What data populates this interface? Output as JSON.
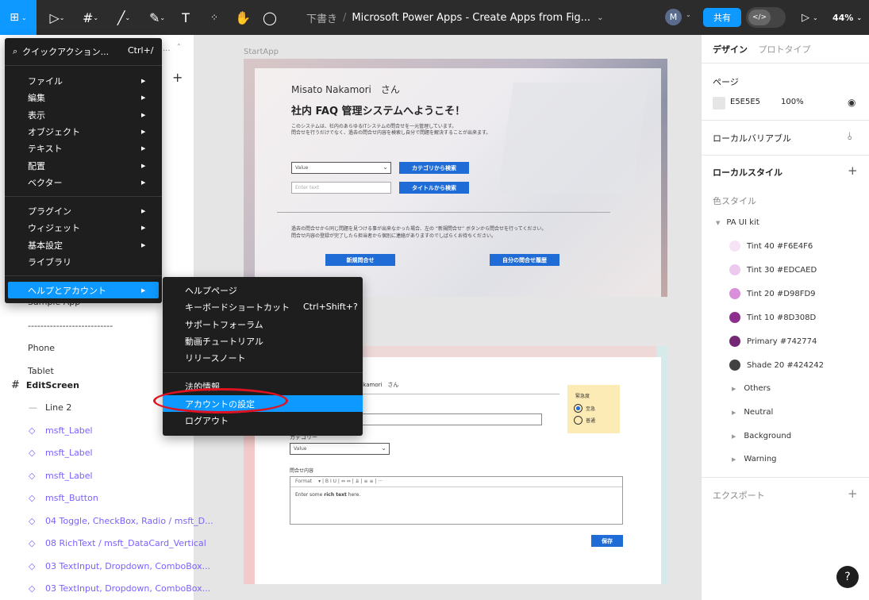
{
  "toolbar": {
    "draft_label": "下書き",
    "separator": "/",
    "file_title": "Microsoft Power Apps - Create Apps from Fig...",
    "avatar_letter": "M",
    "share_label": "共有",
    "dev_mode_label": "</>",
    "zoom": "44%"
  },
  "main_menu": {
    "quick_action": {
      "label": "クイックアクション...",
      "shortcut": "Ctrl+/"
    },
    "items_group1": [
      {
        "label": "ファイル"
      },
      {
        "label": "編集"
      },
      {
        "label": "表示"
      },
      {
        "label": "オブジェクト"
      },
      {
        "label": "テキスト"
      },
      {
        "label": "配置"
      },
      {
        "label": "ベクター"
      }
    ],
    "items_group2": [
      {
        "label": "プラグイン"
      },
      {
        "label": "ウィジェット"
      },
      {
        "label": "基本設定"
      },
      {
        "label": "ライブラリ"
      }
    ],
    "help_account": {
      "label": "ヘルプとアカウント"
    }
  },
  "help_submenu": {
    "items_group1": [
      {
        "label": "ヘルプページ",
        "shortcut": ""
      },
      {
        "label": "キーボードショートカット",
        "shortcut": "Ctrl+Shift+?"
      },
      {
        "label": "サポートフォーラム",
        "shortcut": ""
      },
      {
        "label": "動画チュートリアル",
        "shortcut": ""
      },
      {
        "label": "リリースノート",
        "shortcut": ""
      }
    ],
    "legal": "法的情報",
    "account_settings": "アカウントの設定",
    "logout": "ログアウト"
  },
  "layers": {
    "collapsed_hint": "...",
    "sample_app": "Sample App",
    "divider_text": "---------------------------",
    "phone": "Phone",
    "tablet": "Tablet",
    "edit_screen": "EditScreen",
    "children": [
      {
        "label": "Line 2",
        "kind": "line"
      },
      {
        "label": "msft_Label",
        "kind": "component"
      },
      {
        "label": "msft_Label",
        "kind": "component"
      },
      {
        "label": "msft_Label",
        "kind": "component"
      },
      {
        "label": "msft_Button",
        "kind": "component"
      },
      {
        "label": "04 Toggle, CheckBox, Radio / msft_D...",
        "kind": "component"
      },
      {
        "label": "08 RichText / msft_DataCard_Vertical",
        "kind": "component"
      },
      {
        "label": "03 TextInput, Dropdown, ComboBox...",
        "kind": "component"
      },
      {
        "label": "03 TextInput, Dropdown, ComboBox...",
        "kind": "component"
      }
    ]
  },
  "canvas": {
    "frame1_label": "StartApp",
    "frame1": {
      "user_name": "Misato Nakamori　さん",
      "welcome": "社内 FAQ 管理システムへようこそ！",
      "desc_line1": "このシステムは、社内のあらゆるITシステムの問合せを一元管理しています。",
      "desc_line2": "問合せを行うだけでなく、過去の問合せ内容を検索し自分で問題を解決することが出来ます。",
      "dropdown_value": "Value",
      "input_placeholder": "Enter text",
      "btn_category": "カテゴリから検索",
      "btn_title": "タイトルから検索",
      "note_line1": "過去の問合せから同じ問題を見つける事が出来なかった場合、左の “新規問合せ” ボタンから問合せを行ってください。",
      "note_line2": "問合せ内容の登録が完了したら担当者から個別に連絡がありますのでしばらくお待ちください。",
      "btn_new": "新規問合せ",
      "btn_history": "自分の問合せ履歴"
    },
    "frame2": {
      "user_name_partial": "akamori　さん",
      "category_label": "カテゴリー",
      "dropdown_value": "Value",
      "content_label": "問合せ内容",
      "editor_format": "Format",
      "editor_tools": "▾ | B  I  U | ⇔  ⇔ | ⇊ | ≡  ≡ | ···",
      "editor_placeholder_pre": "Enter some ",
      "editor_placeholder_bold": "rich text",
      "editor_placeholder_post": " here.",
      "urgency_label": "緊急度",
      "radio_urgent": "至急",
      "radio_normal": "普通",
      "save": "保存"
    }
  },
  "right_panel": {
    "tab_design": "デザイン",
    "tab_prototype": "プロトタイプ",
    "page_label": "ページ",
    "page_color_hex": "E5E5E5",
    "page_opacity": "100%",
    "local_variables": "ローカルバリアブル",
    "local_styles": "ローカルスタイル",
    "color_styles": "色スタイル",
    "kit_name": "PA UI kit",
    "colors": [
      {
        "name": "Tint 40 #F6E4F6",
        "hex": "#F6E4F6"
      },
      {
        "name": "Tint 30 #EDCAED",
        "hex": "#EDCAED"
      },
      {
        "name": "Tint 20 #D98FD9",
        "hex": "#D98FD9"
      },
      {
        "name": "Tint 10 #8D308D",
        "hex": "#8D308D"
      },
      {
        "name": "Primary #742774",
        "hex": "#742774"
      },
      {
        "name": "Shade 20 #424242",
        "hex": "#424242"
      }
    ],
    "groups": [
      {
        "name": "Others"
      },
      {
        "name": "Neutral"
      },
      {
        "name": "Background"
      },
      {
        "name": "Warning"
      }
    ],
    "export": "エクスポート",
    "help": "?"
  },
  "colors": {
    "accent": "#0D99FF",
    "toolbar_bg": "#2C2C2C",
    "menu_bg": "#1E1E1E",
    "highlight_ring": "#E0121F"
  }
}
